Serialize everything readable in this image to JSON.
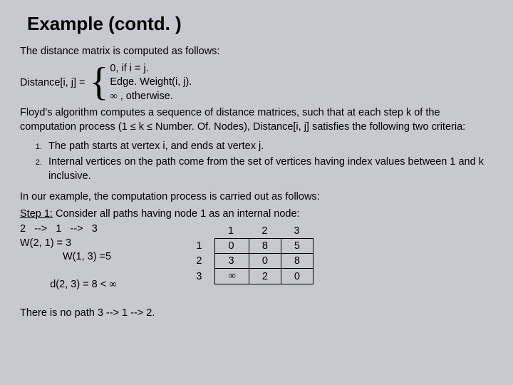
{
  "title": "Example (contd. )",
  "intro": "The distance matrix is computed as follows:",
  "distance_label": "Distance[i, j] = ",
  "cases": {
    "c1": "0, if i = j.",
    "c2": "Edge. Weight(i, j).",
    "c3_prefix": "",
    "c3_inf": "∞",
    "c3_suffix": " , otherwise."
  },
  "floyd_text": "Floyd's algorithm computes a sequence of distance matrices, such that at each step k of the computation process (1 ≤ k ≤ Number. Of. Nodes), Distance[i, j] satisfies the following two criteria:",
  "criteria": [
    "The path starts at vertex i, and ends at vertex j.",
    "Internal vertices on the path come from the set of vertices having index values between 1 and k inclusive."
  ],
  "example_lead": "In our example, the computation process is carried out as follows:",
  "step1_label": "Step 1:",
  "step1_rest": " Consider all paths having node 1 as an internal node:",
  "path_line": "2   -->   1   -->   3",
  "w21": "W(2, 1) = 3",
  "w13": "W(1, 3) =5",
  "d23_prefix": "d(2, 3) = 8 < ",
  "d23_inf": "∞",
  "nopath": "There is no path 3 --> 1 --> 2.",
  "table": {
    "cols": [
      "1",
      "2",
      "3"
    ],
    "rows": [
      {
        "h": "1",
        "cells": [
          "0",
          "8",
          "5"
        ]
      },
      {
        "h": "2",
        "cells": [
          "3",
          "0",
          "8"
        ]
      },
      {
        "h": "3",
        "cells": [
          "∞",
          "2",
          "0"
        ]
      }
    ]
  }
}
